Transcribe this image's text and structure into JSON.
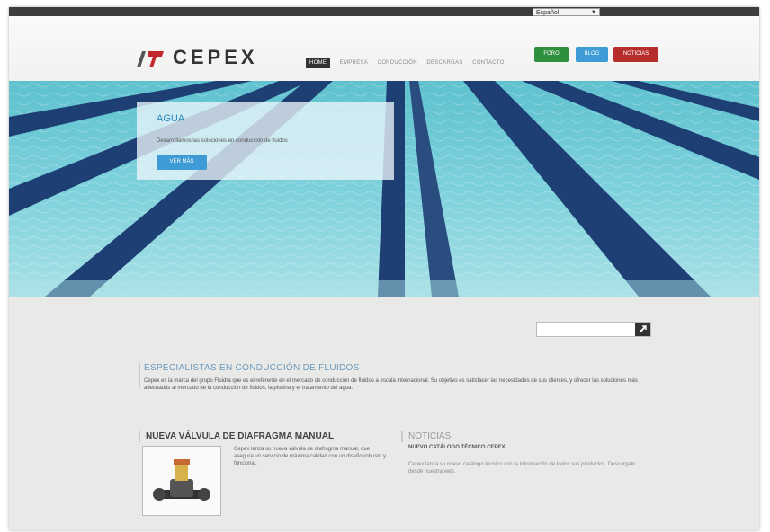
{
  "header": {
    "logo_text": "CEPEX",
    "language": "Español",
    "nav": [
      "HOME",
      "EMPRESA",
      "CONDUCCIÓN",
      "DESCARGAS",
      "CONTACTO"
    ],
    "buttons": {
      "green": "FORO",
      "blue": "BLOG",
      "red": "NOTICIAS"
    }
  },
  "hero": {
    "title": "AGUA",
    "text": "Desarrollamos las soluciones en conducción de fluidos",
    "button": "VER MÁS"
  },
  "intro": {
    "title": "ESPECIALISTAS EN CONDUCCIÓN DE FLUIDOS",
    "text": "Cepex es la marca del grupo Fluidra que es el referente en el mercado de conducción de fluidos a escala internacional. Su objetivo es satisfacer las necesidades de sus clientes, y ofrecer las soluciones más adecuadas al mercado de la conducción de fluidos, la piscina y el tratamiento del agua."
  },
  "news_left": {
    "title": "NUEVA VÁLVULA DE DIAFRAGMA MANUAL",
    "text": "Cepex lanza su nueva válvula de diafragma manual, que asegura un servicio de máxima calidad con un diseño robusto y funcional."
  },
  "news_right": {
    "title": "NOTICIAS",
    "subtitle": "NUEVO CATÁLOGO TÉCNICO CEPEX",
    "text": "Cepex lanza su nuevo catálogo técnico con la información de todos sus productos. Descárgalo desde nuestra web."
  }
}
